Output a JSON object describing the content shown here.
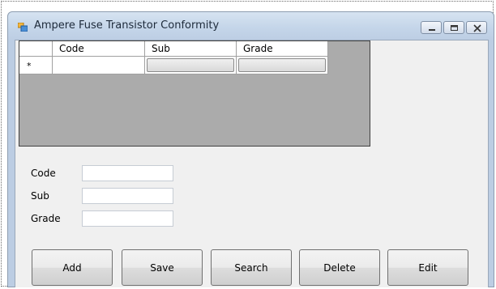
{
  "window": {
    "title": "Ampere Fuse Transistor Conformity"
  },
  "grid": {
    "columns": [
      "Code",
      "Sub",
      "Grade"
    ],
    "new_row_marker": "*"
  },
  "form": {
    "code_label": "Code",
    "sub_label": "Sub",
    "grade_label": "Grade",
    "code_value": "",
    "sub_value": "",
    "grade_value": ""
  },
  "buttons": {
    "add": "Add",
    "save": "Save",
    "search": "Search",
    "delete": "Delete",
    "edit": "Edit"
  },
  "colors": {
    "grid_background": "#ababab",
    "client_background": "#f0f0f0",
    "titlebar": "#c4d5e9"
  }
}
